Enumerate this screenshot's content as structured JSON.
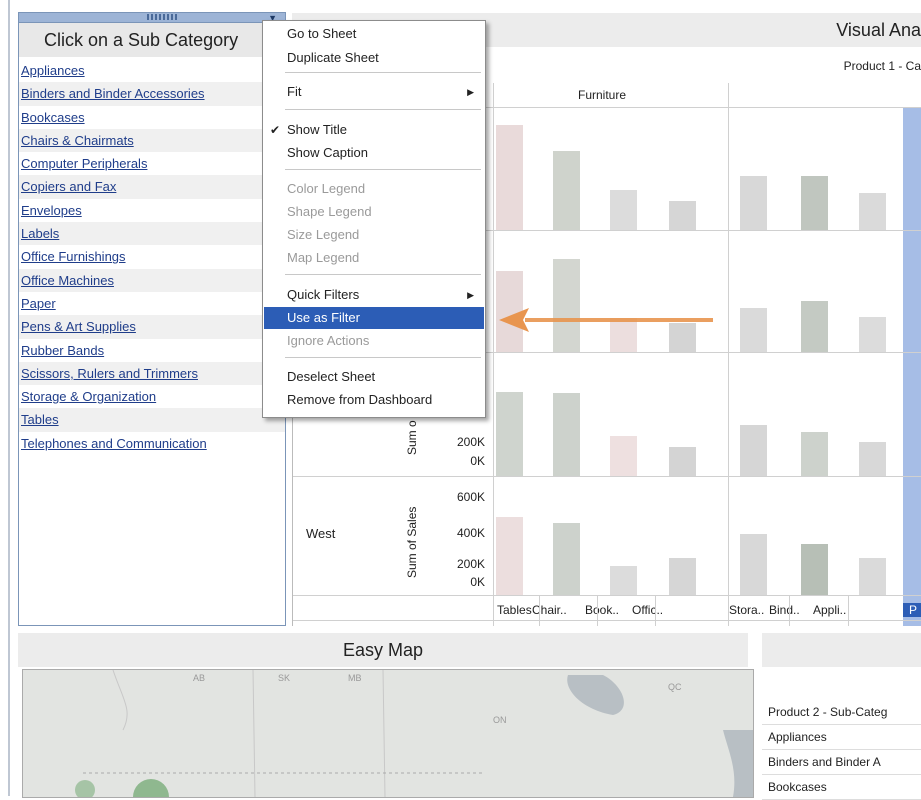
{
  "left_panel": {
    "title": "Click on a Sub Category",
    "dropdown_icon": "chevron-down-icon",
    "items": [
      "Appliances",
      "Binders and Binder Accessories",
      "Bookcases",
      "Chairs & Chairmats",
      "Computer Peripherals",
      "Copiers and Fax",
      "Envelopes",
      "Labels",
      "Office Furnishings",
      "Office Machines",
      "Paper",
      "Pens & Art Supplies",
      "Rubber Bands",
      "Scissors, Rulers and Trimmers",
      "Storage & Organization",
      "Tables",
      "Telephones and Communication"
    ]
  },
  "context_menu": {
    "items": [
      {
        "label": "Go to Sheet",
        "state": "enabled"
      },
      {
        "label": "Duplicate Sheet",
        "state": "enabled"
      },
      {
        "label": "Fit",
        "state": "enabled",
        "submenu": true
      },
      {
        "label": "Show Title",
        "state": "enabled",
        "checked": true
      },
      {
        "label": "Show Caption",
        "state": "enabled"
      },
      {
        "label": "Color Legend",
        "state": "disabled"
      },
      {
        "label": "Shape Legend",
        "state": "disabled"
      },
      {
        "label": "Size Legend",
        "state": "disabled"
      },
      {
        "label": "Map Legend",
        "state": "disabled"
      },
      {
        "label": "Quick Filters",
        "state": "enabled",
        "submenu": true
      },
      {
        "label": "Use as Filter",
        "state": "highlighted"
      },
      {
        "label": "Ignore Actions",
        "state": "disabled"
      },
      {
        "label": "Deselect Sheet",
        "state": "enabled"
      },
      {
        "label": "Remove from Dashboard",
        "state": "enabled"
      }
    ]
  },
  "chart": {
    "title": "Visual Ana",
    "subtitle": "Product 1 - Ca",
    "category_header": "Furniture",
    "region_labels": [
      "West"
    ],
    "ylabel": "Sum of Sales",
    "ylabel_partial": "Sum o",
    "ticks_row3": [
      "200K",
      "0K"
    ],
    "ticks_row4": [
      "600K",
      "400K",
      "200K",
      "0K"
    ],
    "x_categories": [
      "Tables",
      "Chair..",
      "Book..",
      "Offic..",
      "Stora..",
      "Bind..",
      "Appli..",
      "P"
    ]
  },
  "chart_data": {
    "type": "bar",
    "categories": [
      "Tables",
      "Chair..",
      "Book..",
      "Offic..",
      "Stora..",
      "Bind..",
      "Appli.."
    ],
    "series": [
      {
        "values": [
          620000,
          470000,
          240000,
          170000,
          320000,
          320000,
          220000
        ]
      },
      {
        "values": [
          480000,
          550000,
          200000,
          170000,
          260000,
          300000,
          210000
        ]
      },
      {
        "values": [
          500000,
          490000,
          240000,
          170000,
          300000,
          260000,
          200000
        ]
      },
      {
        "name": "West",
        "values": [
          460000,
          430000,
          170000,
          220000,
          360000,
          300000,
          220000
        ]
      }
    ],
    "ylabel": "Sum of Sales",
    "ylim": [
      0,
      700000
    ]
  },
  "map": {
    "title": "Easy Map",
    "labels": [
      "AB",
      "SK",
      "MB",
      "ON",
      "QC"
    ]
  },
  "right_table": {
    "rows": [
      "Product 2 - Sub-Categ",
      "Appliances",
      "Binders and Binder A",
      "Bookcases"
    ]
  },
  "colors": {
    "menu_highlight": "#2c5db6",
    "arrow": "#e8954f",
    "link": "#1f3d8a",
    "panel_border": "#7b95b8"
  }
}
